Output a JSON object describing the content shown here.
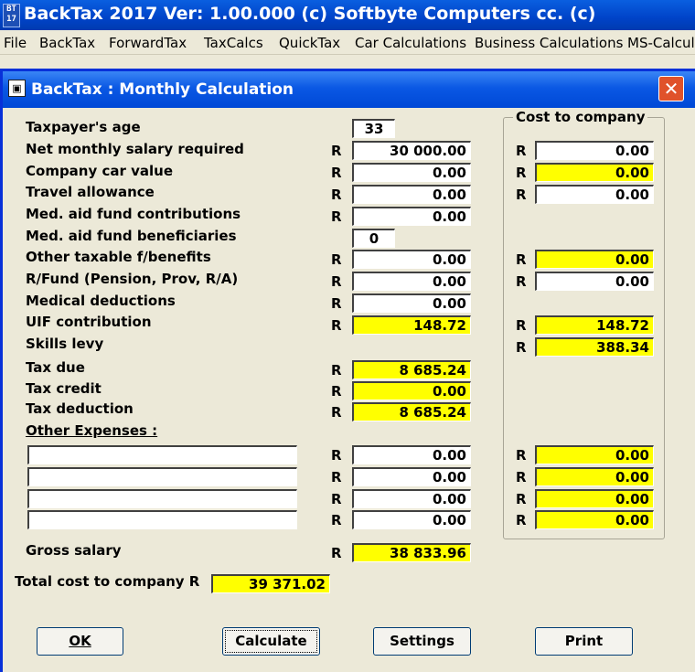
{
  "app": {
    "icon_text": "BT\n17",
    "title": "BackTax 2017 Ver: 1.00.000  (c) Softbyte Computers cc. (c)"
  },
  "menu": [
    "File",
    "BackTax",
    "ForwardTax",
    "TaxCalcs",
    "QuickTax",
    "Car Calculations",
    "Business Calculations",
    "MS-Calcula"
  ],
  "dialog": {
    "title": "BackTax : Monthly Calculation",
    "close_symbol": "✕",
    "currency": "R",
    "cost_group_title": "Cost to company",
    "rows": {
      "age": {
        "label": "Taxpayer's age",
        "value": "33"
      },
      "salary": {
        "label": "Net monthly salary required",
        "value": "30 000.00",
        "cost": "0.00"
      },
      "car": {
        "label": "Company car value",
        "value": "0.00",
        "cost": "0.00"
      },
      "travel": {
        "label": "Travel allowance",
        "value": "0.00",
        "cost": "0.00"
      },
      "medaid": {
        "label": "Med. aid fund contributions",
        "value": "0.00"
      },
      "beneficiaries": {
        "label": "Med. aid fund beneficiaries",
        "value": "0"
      },
      "other_fb": {
        "label": "Other taxable f/benefits",
        "value": "0.00",
        "cost": "0.00"
      },
      "rfund": {
        "label": "R/Fund (Pension, Prov, R/A)",
        "value": "0.00",
        "cost": "0.00"
      },
      "medical": {
        "label": "Medical deductions",
        "value": "0.00"
      },
      "uif": {
        "label": "UIF contribution",
        "value": "148.72",
        "cost": "148.72"
      },
      "skills": {
        "label": "Skills levy",
        "cost": "388.34"
      },
      "taxdue": {
        "label": "Tax due",
        "value": "8 685.24"
      },
      "taxcredit": {
        "label": "Tax credit",
        "value": "0.00"
      },
      "taxded": {
        "label": "Tax deduction",
        "value": "8 685.24"
      }
    },
    "other_expenses_label": "Other Expenses :",
    "expenses": [
      {
        "description": "",
        "value": "0.00",
        "cost": "0.00"
      },
      {
        "description": "",
        "value": "0.00",
        "cost": "0.00"
      },
      {
        "description": "",
        "value": "0.00",
        "cost": "0.00"
      },
      {
        "description": "",
        "value": "0.00",
        "cost": "0.00"
      }
    ],
    "gross": {
      "label": "Gross salary",
      "value": "38 833.96"
    },
    "total": {
      "label": "Total cost to company R",
      "value": "39 371.02"
    },
    "buttons": {
      "ok": "OK",
      "calculate": "Calculate",
      "settings": "Settings",
      "print": "Print"
    }
  }
}
